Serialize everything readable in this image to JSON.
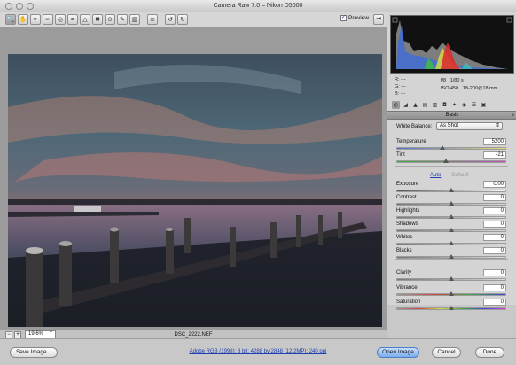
{
  "window": {
    "title": "Camera Raw 7.0  –  Nikon D5000"
  },
  "toolbar": {
    "tools": [
      {
        "name": "zoom-tool-icon",
        "glyph": "🔍",
        "selected": true
      },
      {
        "name": "hand-tool-icon",
        "glyph": "✋",
        "selected": false
      },
      {
        "name": "white-balance-tool-icon",
        "glyph": "✒",
        "selected": false
      },
      {
        "name": "color-sampler-tool-icon",
        "glyph": "✑",
        "selected": false
      },
      {
        "name": "targeted-adjustment-tool-icon",
        "glyph": "◎",
        "selected": false
      },
      {
        "name": "crop-tool-icon",
        "glyph": "⌗",
        "selected": false
      },
      {
        "name": "straighten-tool-icon",
        "glyph": "△",
        "selected": false
      },
      {
        "name": "spot-removal-tool-icon",
        "glyph": "✖",
        "selected": false
      },
      {
        "name": "red-eye-tool-icon",
        "glyph": "⊙",
        "selected": false
      },
      {
        "name": "adjustment-brush-icon",
        "glyph": "✎",
        "selected": false
      },
      {
        "name": "graduated-filter-icon",
        "glyph": "▥",
        "selected": false
      },
      {
        "name": "preferences-icon",
        "glyph": "≡",
        "selected": false
      },
      {
        "name": "rotate-left-icon",
        "glyph": "↺",
        "selected": false
      },
      {
        "name": "rotate-right-icon",
        "glyph": "↻",
        "selected": false
      }
    ],
    "preview_label": "Preview",
    "preview_checked": "✓"
  },
  "histogram": {
    "rgb_labels": [
      "R:",
      "G:",
      "B:"
    ],
    "rgb_values": [
      "---",
      "---",
      "---"
    ],
    "aperture": "f/8",
    "shutter": "1/80 s",
    "iso": "ISO 450",
    "lens": "18-200@18 mm"
  },
  "panel_tabs": [
    {
      "name": "basic-tab-icon",
      "glyph": "◐",
      "selected": true
    },
    {
      "name": "tone-curve-tab-icon",
      "glyph": "◢",
      "selected": false
    },
    {
      "name": "detail-tab-icon",
      "glyph": "▲",
      "selected": false
    },
    {
      "name": "hsl-tab-icon",
      "glyph": "▤",
      "selected": false
    },
    {
      "name": "split-toning-tab-icon",
      "glyph": "▥",
      "selected": false
    },
    {
      "name": "lens-corrections-tab-icon",
      "glyph": "◘",
      "selected": false
    },
    {
      "name": "effects-tab-icon",
      "glyph": "✦",
      "selected": false
    },
    {
      "name": "camera-calibration-tab-icon",
      "glyph": "◉",
      "selected": false
    },
    {
      "name": "presets-tab-icon",
      "glyph": "☰",
      "selected": false
    },
    {
      "name": "snapshots-tab-icon",
      "glyph": "▣",
      "selected": false
    }
  ],
  "basic": {
    "panel_title": "Basic",
    "white_balance_label": "White Balance:",
    "white_balance_value": "As Shot",
    "auto_label": "Auto",
    "default_label": "Default",
    "sliders": [
      {
        "key": "temperature",
        "label": "Temperature",
        "value": "5200",
        "fraction": 0.42,
        "gradient": "linear-gradient(90deg,#4f6fd0,#e8e07a)"
      },
      {
        "key": "tint",
        "label": "Tint",
        "value": "-21",
        "fraction": 0.45,
        "gradient": "linear-gradient(90deg,#3fb03f,#c84fc8)"
      },
      {
        "key": "exposure",
        "label": "Exposure",
        "value": "0.00",
        "fraction": 0.5,
        "gradient": "linear-gradient(90deg,#555,#fafafa)"
      },
      {
        "key": "contrast",
        "label": "Contrast",
        "value": "0",
        "fraction": 0.5,
        "gradient": "linear-gradient(90deg,#777,#ddd)"
      },
      {
        "key": "highlights",
        "label": "Highlights",
        "value": "0",
        "fraction": 0.5,
        "gradient": "linear-gradient(90deg,#777,#ddd)"
      },
      {
        "key": "shadows",
        "label": "Shadows",
        "value": "0",
        "fraction": 0.5,
        "gradient": "linear-gradient(90deg,#777,#ddd)"
      },
      {
        "key": "whites",
        "label": "Whites",
        "value": "0",
        "fraction": 0.5,
        "gradient": "linear-gradient(90deg,#777,#ddd)"
      },
      {
        "key": "blacks",
        "label": "Blacks",
        "value": "0",
        "fraction": 0.5,
        "gradient": "linear-gradient(90deg,#777,#ddd)"
      },
      {
        "key": "clarity",
        "label": "Clarity",
        "value": "0",
        "fraction": 0.5,
        "gradient": "linear-gradient(90deg,#777,#ddd)"
      },
      {
        "key": "vibrance",
        "label": "Vibrance",
        "value": "0",
        "fraction": 0.5,
        "gradient": "linear-gradient(90deg,#999,#d44,#4a4,#44d)"
      },
      {
        "key": "saturation",
        "label": "Saturation",
        "value": "0",
        "fraction": 0.5,
        "gradient": "linear-gradient(90deg,#999,#d44,#dd4,#4a4,#44d,#d4d)"
      }
    ]
  },
  "footer": {
    "zoom_value": "19.6%",
    "filename": "DSC_2222.NEF",
    "save_label": "Save Image...",
    "workflow_link": "Adobe RGB (1998); 8 bit; 4288 by 2848 (12.2MP); 240 ppi",
    "open_label": "Open Image",
    "cancel_label": "Cancel",
    "done_label": "Done"
  }
}
